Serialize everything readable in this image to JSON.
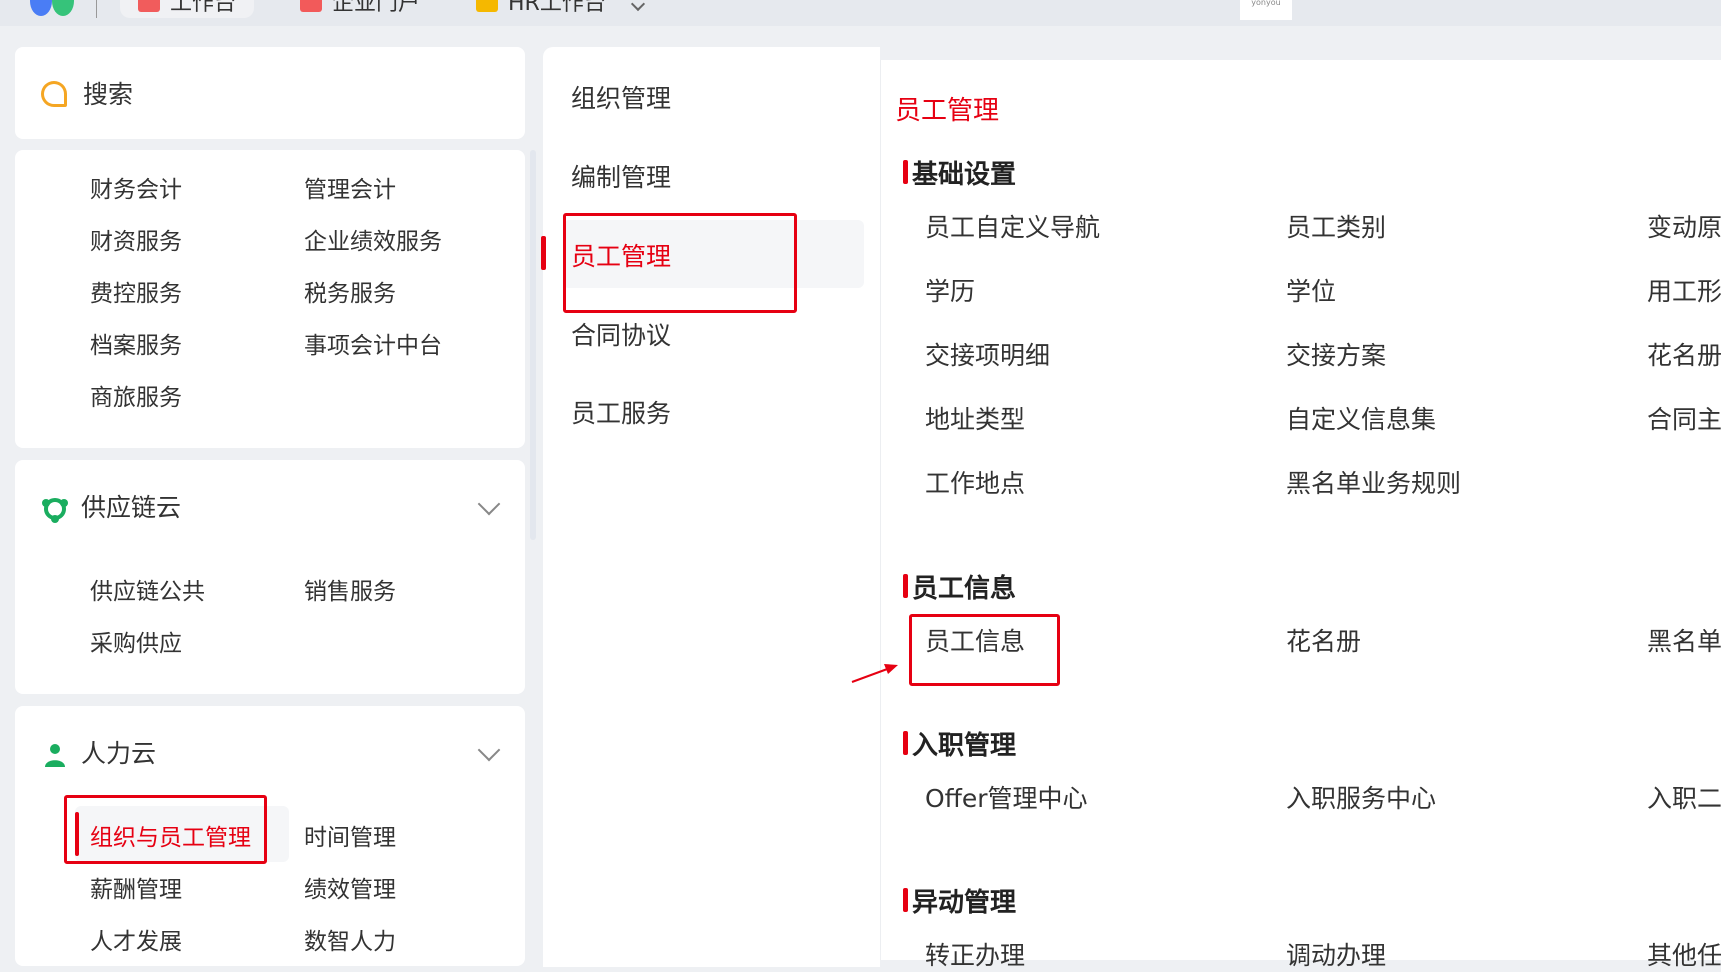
{
  "topbar": {
    "tabs": [
      "工作台",
      "企业门户",
      "HR工作台"
    ],
    "brand": "yonyou"
  },
  "search": {
    "label": "搜索"
  },
  "finance_items": [
    "财务会计",
    "管理会计",
    "财资服务",
    "企业绩效服务",
    "费控服务",
    "税务服务",
    "档案服务",
    "事项会计中台",
    "商旅服务"
  ],
  "supply_chain": {
    "title": "供应链云",
    "items": [
      "供应链公共",
      "销售服务",
      "采购供应"
    ]
  },
  "hr_cloud": {
    "title": "人力云",
    "items": [
      "组织与员工管理",
      "时间管理",
      "薪酬管理",
      "绩效管理",
      "人才发展",
      "数智人力"
    ]
  },
  "middle_menu": [
    "组织管理",
    "编制管理",
    "员工管理",
    "合同协议",
    "员工服务"
  ],
  "right": {
    "title": "员工管理",
    "sections": [
      {
        "title": "基础设置",
        "items": [
          "员工自定义导航",
          "员工类别",
          "变动原",
          "学历",
          "学位",
          "用工形",
          "交接项明细",
          "交接方案",
          "花名册",
          "地址类型",
          "自定义信息集",
          "合同主",
          "工作地点",
          "黑名单业务规则"
        ]
      },
      {
        "title": "员工信息",
        "items": [
          "员工信息",
          "花名册",
          "黑名单"
        ]
      },
      {
        "title": "入职管理",
        "items": [
          "Offer管理中心",
          "入职服务中心",
          "入职二"
        ]
      },
      {
        "title": "异动管理",
        "items": [
          "转正办理",
          "调动办理",
          "其他任"
        ]
      }
    ]
  },
  "colors": {
    "accent": "#e60012",
    "search_icon": "#f5a623",
    "supply_icon": "#1aad5f",
    "hr_icon": "#1aad5f"
  }
}
